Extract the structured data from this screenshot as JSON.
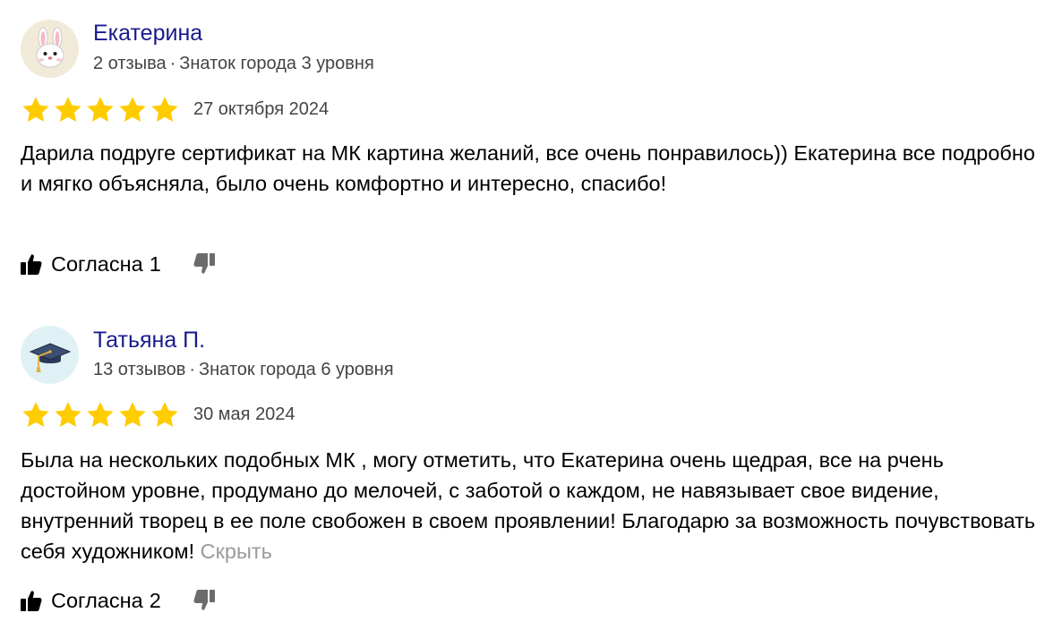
{
  "colors": {
    "author_link": "#1a1a8c",
    "meta_gray": "#444444",
    "star_yellow": "#ffcc00",
    "hide_gray": "#9a9a9a",
    "dislike_gray": "#6b6b6b"
  },
  "reviews": [
    {
      "author": "Екатерина",
      "reviews_count": "2 отзыва",
      "separator": "·",
      "level": "Знаток города 3 уровня",
      "avatar_icon": "bunny-face-icon",
      "rating": 5,
      "date": "27 октября 2024",
      "text": "Дарила подруге сертификат на МК картина желаний, все очень понравилось)) Екатерина все подробно и мягко объясняла, было очень комфортно и интересно, спасибо!",
      "hide_label": "",
      "like_label": "Согласна",
      "like_count": "1",
      "like_icon": "thumbs-up-icon",
      "dislike_icon": "thumbs-down-icon"
    },
    {
      "author": "Татьяна П.",
      "reviews_count": "13 отзывов",
      "separator": "·",
      "level": "Знаток города 6 уровня",
      "avatar_icon": "graduation-cap-icon",
      "rating": 5,
      "date": "30 мая 2024",
      "text": "Была на нескольких подобных МК , могу отметить, что Екатерина очень щедрая, все на рчень достойном уровне, продумано до мелочей, с заботой о каждом, не навязывает свое видение, внутренний творец в ее поле свобожен в своем проявлении! Благодарю за возможность почувствовать себя художником!",
      "hide_label": "Скрыть",
      "like_label": "Согласна",
      "like_count": "2",
      "like_icon": "thumbs-up-icon",
      "dislike_icon": "thumbs-down-icon"
    }
  ]
}
